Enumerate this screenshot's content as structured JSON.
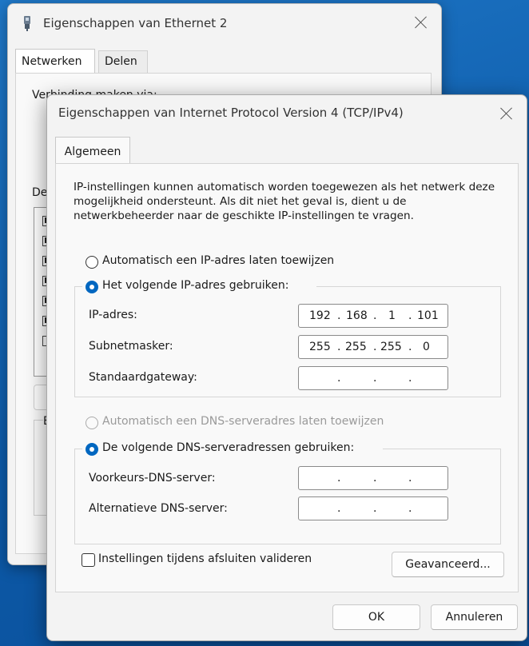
{
  "back_window": {
    "title": "Eigenschappen van Ethernet 2",
    "tabs": [
      "Netwerken",
      "Delen"
    ],
    "partial_label_1": "Verbinding maken via:",
    "partial_label_2": "De",
    "partial_label_3": "E",
    "list_checkboxes": [
      true,
      true,
      true,
      true,
      true,
      true,
      false
    ]
  },
  "dialog": {
    "title": "Eigenschappen van Internet Protocol Version 4 (TCP/IPv4)",
    "tab": "Algemeen",
    "description": "IP-instellingen kunnen automatisch worden toegewezen als het netwerk deze mogelijkheid ondersteunt. Als dit niet het geval is, dient u de netwerkbeheerder naar de geschikte IP-instellingen te vragen.",
    "ip_auto_label": "Automatisch een IP-adres laten toewijzen",
    "ip_manual_label": "Het volgende IP-adres gebruiken:",
    "ip_mode": "manual",
    "fields": {
      "ip": {
        "label": "IP-adres:",
        "octets": [
          "192",
          "168",
          "1",
          "101"
        ]
      },
      "subnet": {
        "label": "Subnetmasker:",
        "octets": [
          "255",
          "255",
          "255",
          "0"
        ]
      },
      "gateway": {
        "label": "Standaardgateway:",
        "octets": [
          "",
          "",
          "",
          ""
        ]
      }
    },
    "dns_auto_label": "Automatisch een DNS-serveradres laten toewijzen",
    "dns_manual_label": "De volgende DNS-serveradressen gebruiken:",
    "dns_mode": "manual",
    "dns_fields": {
      "preferred": {
        "label": "Voorkeurs-DNS-server:",
        "octets": [
          "",
          "",
          "",
          ""
        ]
      },
      "alternate": {
        "label": "Alternatieve DNS-server:",
        "octets": [
          "",
          "",
          "",
          ""
        ]
      }
    },
    "validate_label": "Instellingen tijdens afsluiten valideren",
    "validate_checked": false,
    "advanced_button": "Geavanceerd...",
    "ok_button": "OK",
    "cancel_button": "Annuleren"
  }
}
